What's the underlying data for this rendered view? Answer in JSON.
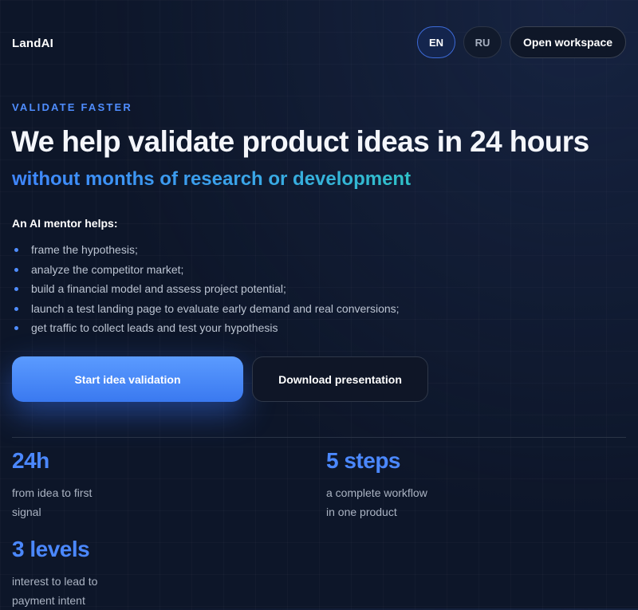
{
  "header": {
    "logo": "LandAI",
    "lang_en": "EN",
    "lang_ru": "RU",
    "workspace_button": "Open workspace"
  },
  "hero": {
    "eyebrow": "VALIDATE FASTER",
    "headline": "We help validate product ideas in 24 hours",
    "subhead": "without months of research or development",
    "mentor_title": "An AI mentor helps:",
    "bullets": [
      "frame the hypothesis;",
      "analyze the competitor market;",
      "build a financial model and assess project potential;",
      "launch a test landing page to evaluate early demand and real conversions;",
      "get traffic to collect leads and test your hypothesis"
    ],
    "primary_cta": "Start idea validation",
    "secondary_cta": "Download presentation"
  },
  "stats": [
    {
      "value": "24h",
      "desc": "from idea to first signal"
    },
    {
      "value": "5 steps",
      "desc": "a complete workflow in one product"
    },
    {
      "value": "3 levels",
      "desc": "interest to lead to payment intent"
    }
  ],
  "colors": {
    "background": "#0d1629",
    "accent": "#4b88ff",
    "gradient_end": "#2fc1c8"
  }
}
